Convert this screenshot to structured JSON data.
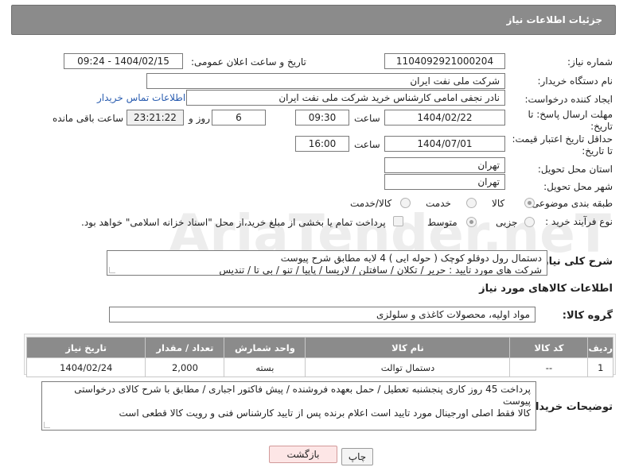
{
  "header": {
    "title": "جزئیات اطلاعات نیاز"
  },
  "form": {
    "need_number_label": "شماره نیاز:",
    "need_number": "1104092921000204",
    "announce_label": "تاریخ و ساعت اعلان عمومی:",
    "announce_value": "1404/02/15 - 09:24",
    "buyer_org_label": "نام دستگاه خریدار:",
    "buyer_org": "شرکت ملی نفت ایران",
    "creator_label": "ایجاد کننده درخواست:",
    "creator": "نادر نجفی امامی کارشناس خرید شرکت ملی نفت ایران",
    "contact_link": "اطلاعات تماس خریدار",
    "reply_deadline_label_1": "مهلت ارسال پاسخ: تا",
    "reply_deadline_label_2": "تاریخ:",
    "reply_date": "1404/02/22",
    "time_label": "ساعت",
    "reply_time": "09:30",
    "days_value": "6",
    "days_label": "روز و",
    "remaining_time": "23:21:22",
    "remaining_label": "ساعت باقی مانده",
    "price_valid_label_1": "حداقل تاریخ اعتبار قیمت:",
    "price_valid_label_2": "تا تاریخ:",
    "price_date": "1404/07/01",
    "price_time_label": "ساعت",
    "price_time": "16:00",
    "province_label": "استان محل تحویل:",
    "province": "تهران",
    "city_label": "شهر محل تحویل:",
    "city": "تهران",
    "category_label": "طبقه بندی موضوعی:",
    "category_options": [
      "کالا",
      "خدمت",
      "کالا/خدمت"
    ],
    "process_label": "نوع فرآیند خرید :",
    "process_options": [
      "جزیی",
      "متوسط"
    ],
    "payment_note": "پرداخت تمام یا بخشی از مبلغ خرید،از محل \"اسناد خزانه اسلامی\" خواهد بود.",
    "summary_label": "شرح کلی نیاز:",
    "summary_line1": "دستمال رول دوقلو کوچک ( حوله ایی ) 4 لایه مطابق شرح پیوست",
    "summary_line2": "شرکت های مورد تایید : حریر / تکلان / سافتلن / لاریسا / پاپیا / تنو / بی تا / تندیس"
  },
  "goods": {
    "section_title": "اطلاعات کالاهای مورد نیاز",
    "group_label": "گروه کالا:",
    "group_value": "مواد اولیه، محصولات کاغذی و سلولزی",
    "columns": [
      "ردیف",
      "کد کالا",
      "نام کالا",
      "واحد شمارش",
      "تعداد / مقدار",
      "تاریخ نیاز"
    ],
    "rows": [
      {
        "row": "1",
        "code": "--",
        "name": "دستمال توالت",
        "unit": "بسته",
        "qty": "2,000",
        "date": "1404/02/24"
      }
    ]
  },
  "buyer_notes": {
    "label": "توضیحات خریدار:",
    "line1": "پرداخت 45 روز کاری پنجشنبه تعطیل / حمل بعهده فروشنده / پیش فاکتور اجباری / مطابق با شرح کالای  درخواستی پیوست",
    "line2": "کالا فقط اصلی اورجینال مورد تایید است اعلام برنده پس از تایید کارشناس فنی  و رویت  کالا  قطعی است"
  },
  "buttons": {
    "print": "چاپ",
    "back": "بازگشت"
  },
  "watermark": {
    "text": "AriaTender.neT"
  }
}
